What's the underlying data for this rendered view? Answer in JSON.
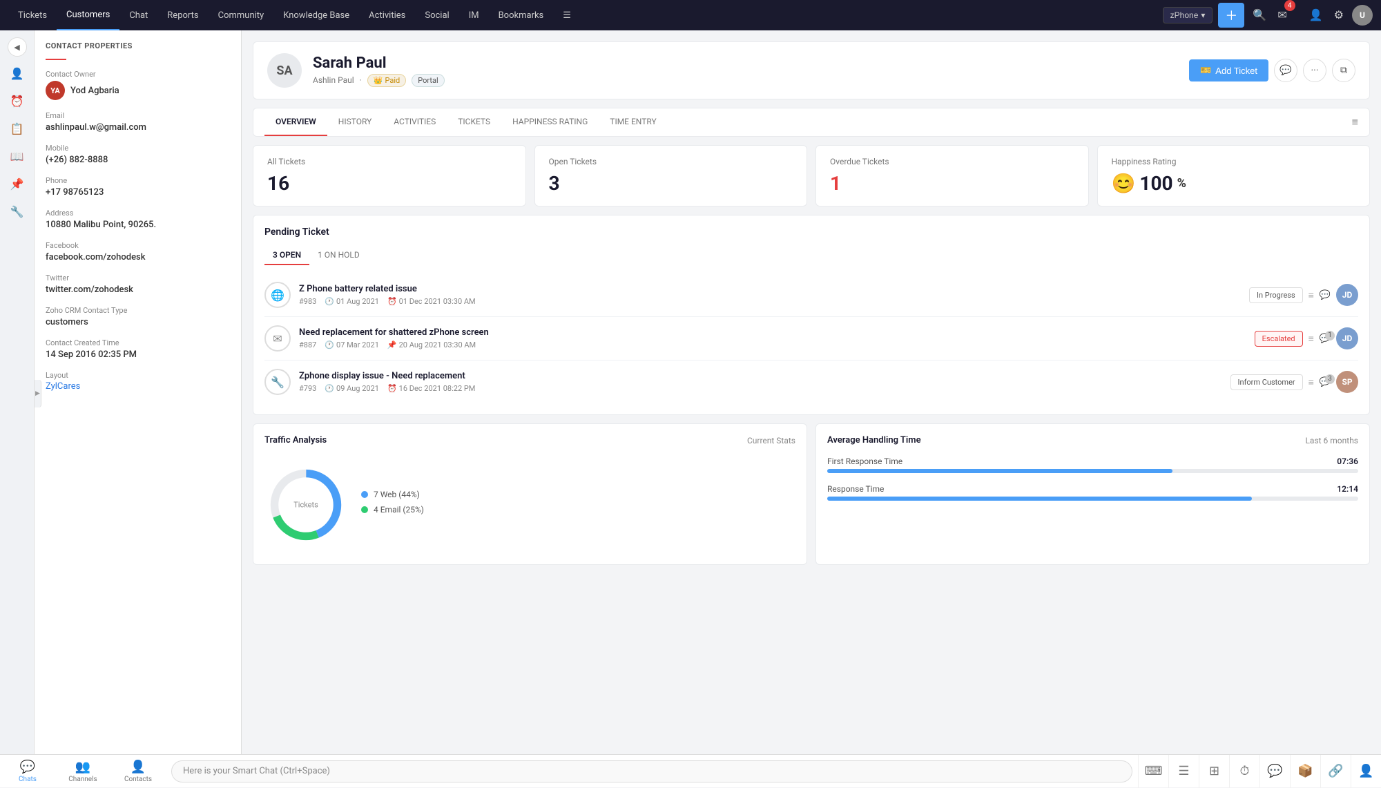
{
  "topNav": {
    "items": [
      {
        "label": "Tickets",
        "active": false
      },
      {
        "label": "Customers",
        "active": true
      },
      {
        "label": "Chat",
        "active": false
      },
      {
        "label": "Reports",
        "active": false
      },
      {
        "label": "Community",
        "active": false
      },
      {
        "label": "Knowledge Base",
        "active": false
      },
      {
        "label": "Activities",
        "active": false
      },
      {
        "label": "Social",
        "active": false
      },
      {
        "label": "IM",
        "active": false
      },
      {
        "label": "Bookmarks",
        "active": false
      }
    ],
    "zphone_label": "zPhone",
    "message_badge": "4",
    "user_initials": "U"
  },
  "contactProperties": {
    "section_title": "CONTACT PROPERTIES",
    "contact_owner_label": "Contact Owner",
    "owner_name": "Yod Agbaria",
    "owner_initials": "YA",
    "fields": [
      {
        "label": "Email",
        "value": "ashlinpaul.w@gmail.com"
      },
      {
        "label": "Mobile",
        "value": "(+26) 882-8888"
      },
      {
        "label": "Phone",
        "value": "+17 98765123"
      },
      {
        "label": "Address",
        "value": "10880 Malibu Point, 90265."
      },
      {
        "label": "Facebook",
        "value": "facebook.com/zohodesk"
      },
      {
        "label": "Twitter",
        "value": "twitter.com/zohodesk"
      },
      {
        "label": "Zoho CRM Contact Type",
        "value": "customers"
      },
      {
        "label": "Contact Created Time",
        "value": "14 Sep 2016 02:35 PM"
      }
    ],
    "layout_label": "Layout",
    "layout_value": "ZylCares"
  },
  "customer": {
    "initials": "SA",
    "name": "Sarah Paul",
    "sub_name": "Ashlin Paul",
    "badge_paid": "Paid",
    "badge_portal": "Portal",
    "add_ticket_btn": "Add Ticket"
  },
  "tabs": [
    {
      "label": "OVERVIEW",
      "active": true
    },
    {
      "label": "HISTORY",
      "active": false
    },
    {
      "label": "ACTIVITIES",
      "active": false
    },
    {
      "label": "TICKETS",
      "active": false
    },
    {
      "label": "HAPPINESS RATING",
      "active": false
    },
    {
      "label": "TIME ENTRY",
      "active": false
    }
  ],
  "stats": [
    {
      "label": "All Tickets",
      "value": "16",
      "red": false
    },
    {
      "label": "Open Tickets",
      "value": "3",
      "red": false
    },
    {
      "label": "Overdue Tickets",
      "value": "1",
      "red": true
    },
    {
      "label": "Happiness Rating",
      "value": "100",
      "suffix": "%",
      "smiley": true
    }
  ],
  "pendingTickets": {
    "title": "Pending Ticket",
    "tabs": [
      {
        "label": "3 OPEN",
        "active": true
      },
      {
        "label": "1 ON HOLD",
        "active": false
      }
    ],
    "tickets": [
      {
        "id": "#983",
        "title": "Z Phone battery related issue",
        "date1": "01 Aug 2021",
        "date2": "01 Dec 2021 03:30 AM",
        "status": "In Progress",
        "status_type": "normal",
        "comments": "",
        "agent_gender": "male",
        "agent_initials": "JD"
      },
      {
        "id": "#887",
        "title": "Need replacement for shattered zPhone screen",
        "date1": "07 Mar 2021",
        "date2": "20 Aug 2021 03:30 AM",
        "status": "Escalated",
        "status_type": "escalated",
        "comments": "1",
        "agent_gender": "male",
        "agent_initials": "JD"
      },
      {
        "id": "#793",
        "title": "Zphone display issue - Need replacement",
        "date1": "09 Aug 2021",
        "date2": "16 Dec 2021 08:22 PM",
        "status": "Inform Customer",
        "status_type": "normal",
        "comments": "3",
        "agent_gender": "female",
        "agent_initials": "SP"
      }
    ]
  },
  "trafficAnalysis": {
    "title": "Traffic Analysis",
    "subtitle": "Current Stats",
    "donut_center_label": "Tickets",
    "legend": [
      {
        "label": "7 Web (44%)",
        "color": "#4a9ef7"
      },
      {
        "label": "4 Email (25%)",
        "color": "#2ecc71"
      }
    ],
    "donut_segments": [
      {
        "label": "Web",
        "value": 44,
        "color": "#4a9ef7"
      },
      {
        "label": "Email",
        "value": 25,
        "color": "#2ecc71"
      },
      {
        "label": "Other",
        "value": 31,
        "color": "#e8eaed"
      }
    ]
  },
  "handlingTime": {
    "title": "Average Handling Time",
    "subtitle": "Last 6 months",
    "items": [
      {
        "label": "First Response Time",
        "value": "07:36",
        "progress": 65
      },
      {
        "label": "Response Time",
        "value": "12:14",
        "progress": 80
      }
    ]
  },
  "bottomToolbar": {
    "items": [
      {
        "label": "Chats",
        "active": true,
        "icon": "💬"
      },
      {
        "label": "Channels",
        "active": false,
        "icon": "👥"
      },
      {
        "label": "Contacts",
        "active": false,
        "icon": "👤"
      }
    ],
    "smart_chat_placeholder": "Here is your Smart Chat (Ctrl+Space)",
    "right_tools": [
      "⌨",
      "☰",
      "⊞",
      "⏰",
      "💭",
      "📦",
      "🔗",
      "👤"
    ]
  }
}
